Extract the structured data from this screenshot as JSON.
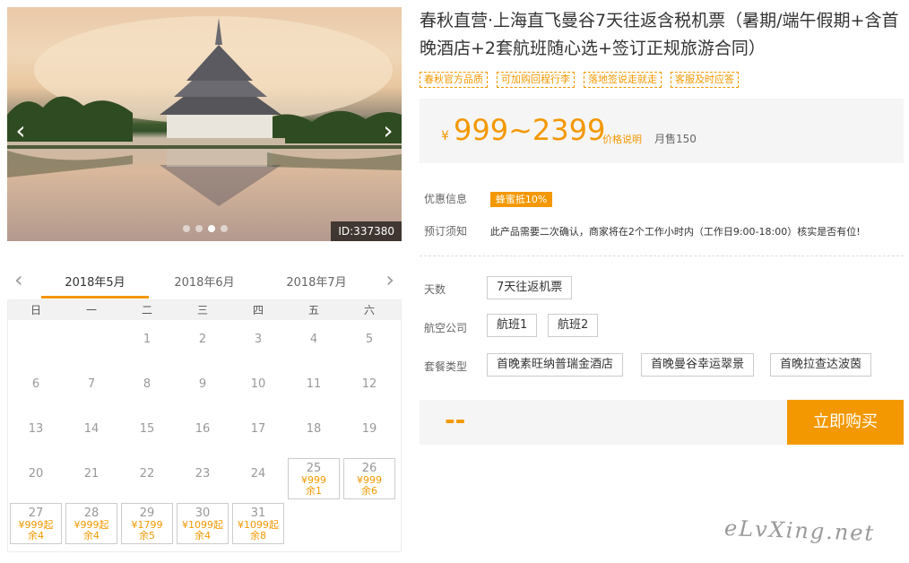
{
  "hero": {
    "image_id": "ID:337380",
    "prev_icon": "chevron-left-icon",
    "next_icon": "chevron-right-icon",
    "slides": 4,
    "active_slide": 2
  },
  "calendar": {
    "months": [
      "2018年5月",
      "2018年6月",
      "2018年7月"
    ],
    "active_month": 0,
    "weekdays": [
      "日",
      "一",
      "二",
      "三",
      "四",
      "五",
      "六"
    ],
    "first_weekday": 2,
    "days_in_month": 31,
    "available": {
      "25": {
        "price": "¥999",
        "left": "余1"
      },
      "26": {
        "price": "¥999",
        "left": "余6"
      },
      "27": {
        "price": "¥999起",
        "left": "余4"
      },
      "28": {
        "price": "¥999起",
        "left": "余4"
      },
      "29": {
        "price": "¥1799",
        "left": "余5"
      },
      "30": {
        "price": "¥1099起",
        "left": "余4"
      },
      "31": {
        "price": "¥1099起",
        "left": "余8"
      }
    }
  },
  "product": {
    "title": "春秋直营·上海直飞曼谷7天往返含税机票（暑期/端午假期+含首晚酒店+2套航班随心选+签订正规旅游合同）",
    "tags": [
      "春秋官方品质",
      "可加购回程行李",
      "落地签说走就走",
      "客服及时应答"
    ],
    "price_symbol": "¥",
    "price_range": "999~2399",
    "price_explain": "价格说明",
    "monthly_sold": "月售150",
    "discount_label": "优惠信息",
    "discount_badge": "蜂蜜抵10%",
    "notice_label": "预订须知",
    "notice_text": "此产品需要二次确认，商家将在2个工作小时内（工作日9:00-18:00）核实是否有位!"
  },
  "options": {
    "days_label": "天数",
    "days": [
      "7天往返机票"
    ],
    "airline_label": "航空公司",
    "airlines": [
      "航班1",
      "航班2"
    ],
    "package_label": "套餐类型",
    "packages": [
      "首晚素旺纳普瑞金酒店",
      "首晚曼谷幸运翠景",
      "首晚拉查达波茵"
    ]
  },
  "purchase": {
    "total": "--",
    "buy_label": "立即购买"
  },
  "watermark": "eLvXing.net",
  "colors": {
    "accent": "#f39800",
    "price_bg": "#f5f5f5"
  }
}
